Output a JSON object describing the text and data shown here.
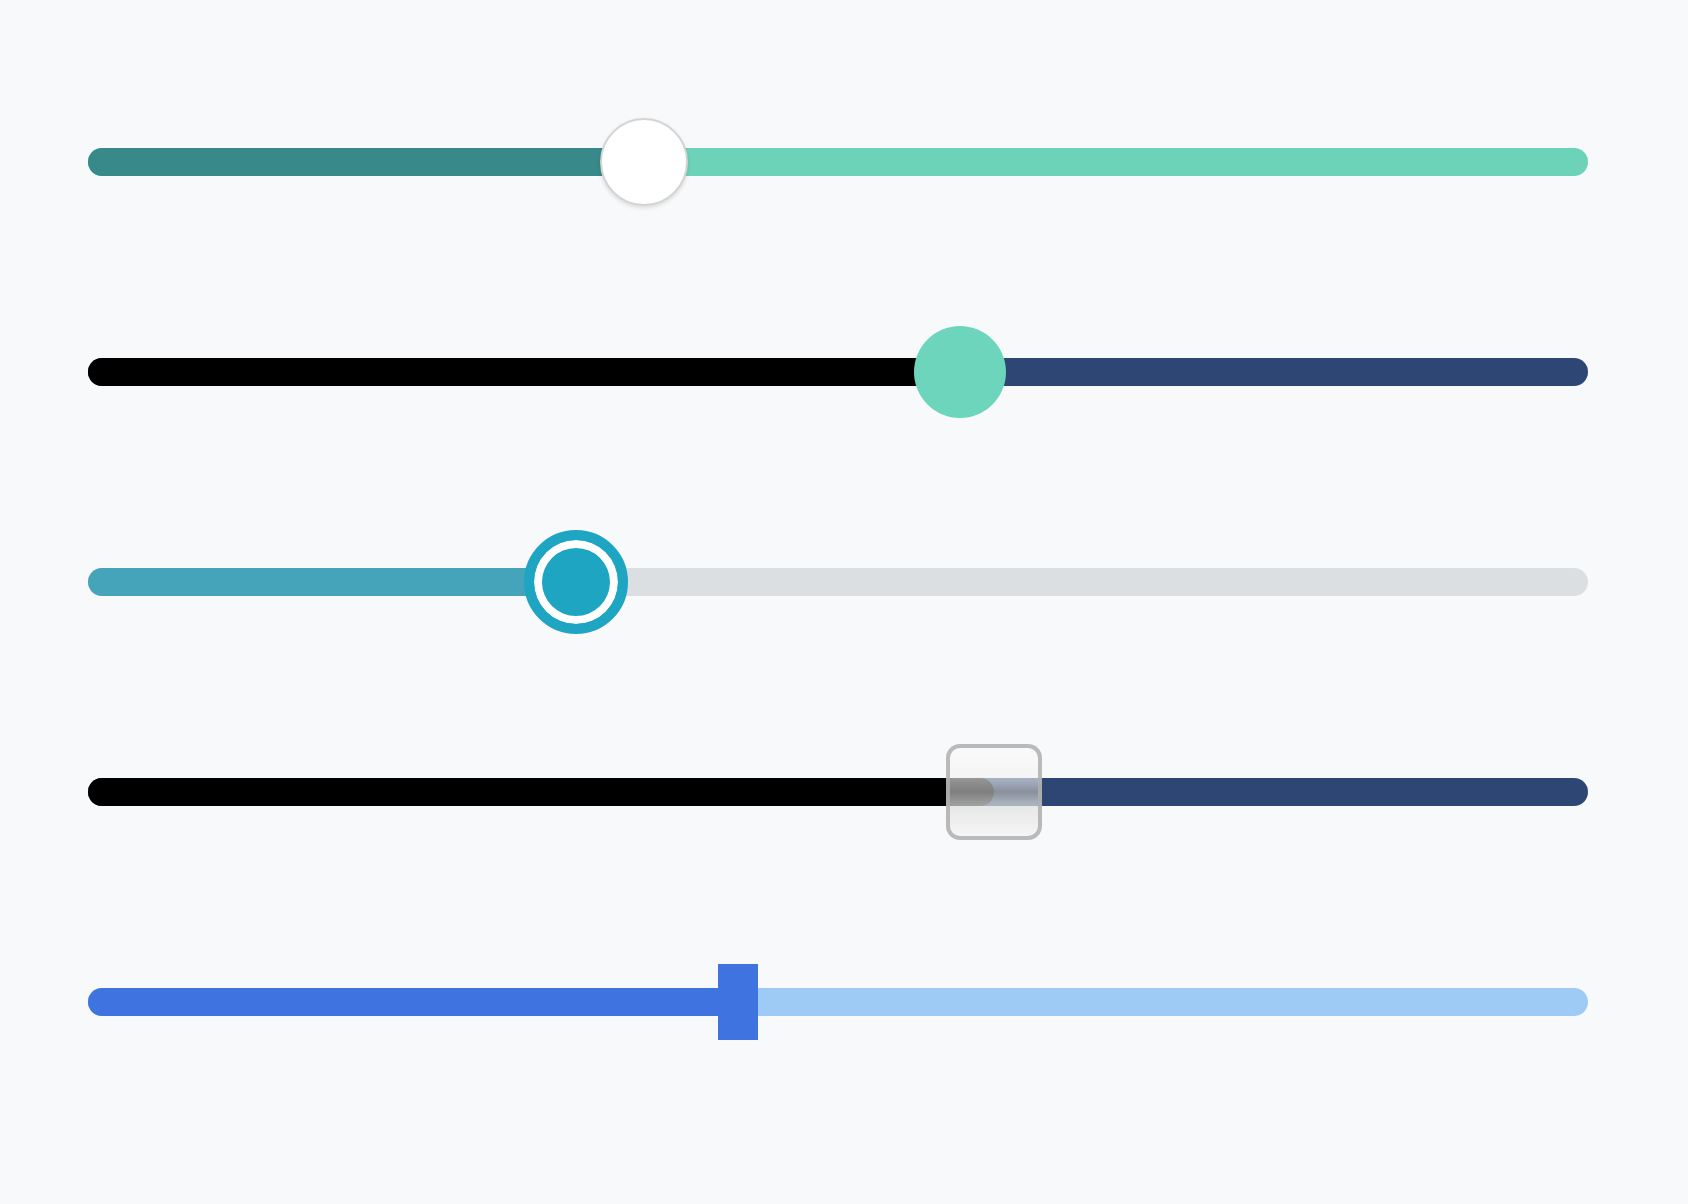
{
  "sliders": [
    {
      "kind": "white-knob",
      "level": 0.371
    },
    {
      "kind": "mint-knob",
      "level": 0.581
    },
    {
      "kind": "ring-knob",
      "level": 0.325
    },
    {
      "kind": "glass-knob",
      "level": 0.604
    },
    {
      "kind": "bar-knob",
      "level": 0.433
    }
  ]
}
